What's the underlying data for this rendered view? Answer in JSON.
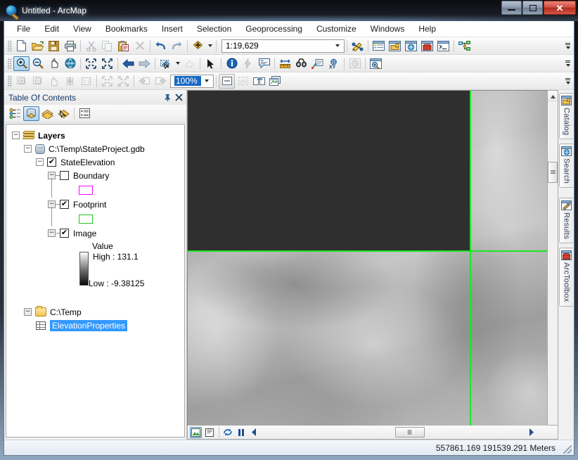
{
  "window": {
    "title": "Untitled - ArcMap",
    "app_icon": "arcmap-globe-icon",
    "buttons": {
      "minimize": "─",
      "maximize": "□",
      "close": "✕"
    }
  },
  "menu": {
    "items": [
      {
        "label": "File"
      },
      {
        "label": "Edit"
      },
      {
        "label": "View"
      },
      {
        "label": "Bookmarks"
      },
      {
        "label": "Insert"
      },
      {
        "label": "Selection"
      },
      {
        "label": "Geoprocessing"
      },
      {
        "label": "Customize"
      },
      {
        "label": "Windows"
      },
      {
        "label": "Help"
      }
    ]
  },
  "standard_toolbar": {
    "buttons": [
      {
        "name": "new-map-icon",
        "enabled": true
      },
      {
        "name": "open-icon",
        "enabled": true
      },
      {
        "name": "save-icon",
        "enabled": true
      },
      {
        "name": "print-icon",
        "enabled": true
      },
      {
        "name": "cut-icon",
        "enabled": false
      },
      {
        "name": "copy-icon",
        "enabled": false
      },
      {
        "name": "paste-icon",
        "enabled": true
      },
      {
        "name": "delete-icon",
        "enabled": false
      },
      {
        "name": "undo-icon",
        "enabled": true
      },
      {
        "name": "redo-icon",
        "enabled": true
      },
      {
        "name": "add-data-icon",
        "enabled": true
      }
    ],
    "scale": {
      "value": "1:19,629",
      "label": "map-scale"
    },
    "right_buttons": [
      {
        "name": "editor-toolbar-icon"
      },
      {
        "name": "table-of-contents-icon"
      },
      {
        "name": "catalog-window-icon"
      },
      {
        "name": "search-window-icon"
      },
      {
        "name": "arctoolbox-icon"
      },
      {
        "name": "python-window-icon"
      },
      {
        "name": "model-builder-icon"
      }
    ]
  },
  "tools_toolbar": {
    "buttons": [
      {
        "name": "zoom-in-icon",
        "active": true
      },
      {
        "name": "zoom-out-icon",
        "active": false
      },
      {
        "name": "pan-icon",
        "active": false
      },
      {
        "name": "full-extent-icon",
        "active": false
      },
      {
        "name": "fixed-zoom-in-icon",
        "active": false
      },
      {
        "name": "fixed-zoom-out-icon",
        "active": false
      },
      {
        "name": "go-back-extent-icon",
        "active": false
      },
      {
        "name": "go-forward-extent-icon",
        "active": false
      },
      {
        "name": "select-features-icon",
        "active": false
      },
      {
        "name": "clear-selection-icon",
        "active": false,
        "enabled": false
      },
      {
        "name": "select-elements-icon",
        "active": false
      },
      {
        "name": "identify-icon",
        "active": false
      },
      {
        "name": "hyperlink-icon",
        "active": false,
        "enabled": false
      },
      {
        "name": "html-popup-icon",
        "active": false
      },
      {
        "name": "measure-icon",
        "active": false
      },
      {
        "name": "find-icon",
        "active": false
      },
      {
        "name": "find-route-icon",
        "active": false
      },
      {
        "name": "go-to-xy-icon",
        "active": false
      },
      {
        "name": "time-slider-icon",
        "active": false,
        "enabled": false
      },
      {
        "name": "create-viewer-window-icon",
        "active": false
      }
    ]
  },
  "layout_toolbar": {
    "buttons": [
      {
        "name": "layout-zoom-in-icon",
        "enabled": false
      },
      {
        "name": "layout-zoom-out-icon",
        "enabled": false
      },
      {
        "name": "layout-pan-icon",
        "enabled": false
      },
      {
        "name": "zoom-whole-page-icon",
        "enabled": false
      },
      {
        "name": "zoom-100-percent-icon",
        "enabled": false
      },
      {
        "name": "fixed-zoom-in-page-icon",
        "enabled": false
      },
      {
        "name": "fixed-zoom-out-page-icon",
        "enabled": false
      },
      {
        "name": "go-back-extent-page-icon",
        "enabled": false
      },
      {
        "name": "go-forward-extent-page-icon",
        "enabled": false
      }
    ],
    "zoom_percent": "100%",
    "right_buttons": [
      {
        "name": "toggle-draft-mode-icon",
        "enabled": true
      },
      {
        "name": "focus-data-frame-icon",
        "enabled": false
      },
      {
        "name": "change-layout-icon",
        "enabled": true
      },
      {
        "name": "data-driven-pages-icon",
        "enabled": true
      }
    ]
  },
  "toc": {
    "title": "Table Of Contents",
    "pin_icon": "pin-icon",
    "close_icon": "close-icon",
    "toolbar": [
      {
        "name": "list-by-drawing-order-icon",
        "active": false
      },
      {
        "name": "list-by-source-icon",
        "active": true
      },
      {
        "name": "list-by-visibility-icon",
        "active": false
      },
      {
        "name": "list-by-selection-icon",
        "active": false
      },
      {
        "name": "options-icon",
        "active": false
      }
    ],
    "tree": {
      "root": {
        "label": "Layers",
        "icon": "layers-icon",
        "expanded": true
      },
      "geodatabase": {
        "label": "C:\\Temp\\StateProject.gdb",
        "icon": "geodatabase-icon",
        "expanded": true
      },
      "dataset": {
        "label": "StateElevation",
        "checked": true,
        "expanded": true
      },
      "children": [
        {
          "label": "Boundary",
          "checked": false,
          "expanded": true,
          "swatch_color": "#ff00ff"
        },
        {
          "label": "Footprint",
          "checked": true,
          "expanded": true,
          "swatch_color": "#00e830"
        },
        {
          "label": "Image",
          "checked": true,
          "expanded": true
        }
      ],
      "raster_legend": {
        "value_label": "Value",
        "high_label": "High : 131.1",
        "low_label": "Low : -9.38125",
        "ramp_high_color": "#ffffff",
        "ramp_low_color": "#000000"
      },
      "folder": {
        "label": "C:\\Temp",
        "icon": "folder-icon",
        "expanded": true
      },
      "table": {
        "label": "ElevationProperties",
        "icon": "table-icon",
        "selected": true
      }
    }
  },
  "map": {
    "nodata_color": "#2f2f2f",
    "footprint_line_color": "#18e824",
    "view_buttons": [
      {
        "name": "data-view-icon",
        "active": true
      },
      {
        "name": "layout-view-icon",
        "active": false
      },
      {
        "name": "refresh-view-icon",
        "active": false
      },
      {
        "name": "pause-drawing-icon",
        "active": false
      },
      {
        "name": "scroll-left-icon",
        "active": false
      }
    ]
  },
  "right_dock": {
    "tabs": [
      {
        "label": "Catalog",
        "icon": "catalog-icon"
      },
      {
        "label": "Search",
        "icon": "search-icon"
      },
      {
        "label": "Results",
        "icon": "results-icon"
      },
      {
        "label": "ArcToolbox",
        "icon": "arctoolbox-icon"
      }
    ]
  },
  "status": {
    "coordinates": "557861.169  191539.291 Meters"
  }
}
